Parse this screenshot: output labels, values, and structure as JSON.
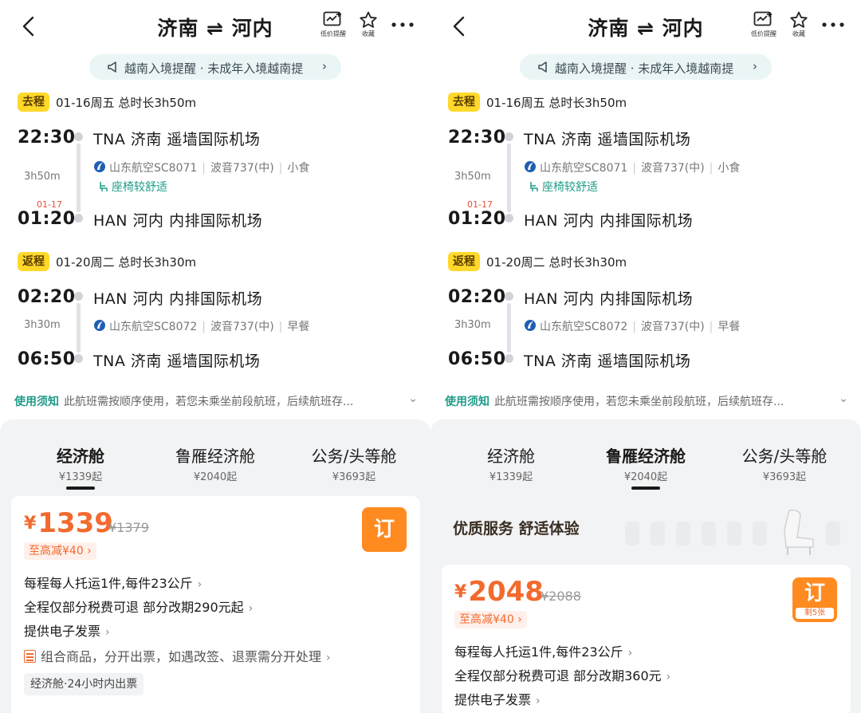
{
  "screens": [
    {
      "header": {
        "title": "济南 ⇌ 河内",
        "watch_label": "低价提醒",
        "fav_label": "收藏"
      },
      "banner": {
        "text": "越南入境提醒 · 未成年入境越南提"
      },
      "outbound": {
        "tag": "去程",
        "info": "01-16周五  总时长3h50m",
        "dep_time": "22:30",
        "arr_time": "01:20",
        "arr_nextday": "01-17",
        "duration": "3h50m",
        "dep_airport": "TNA  济南  遥墙国际机场",
        "arr_airport": "HAN  河内  内排国际机场",
        "airline": "山东航空SC8071",
        "aircraft": "波音737(中)",
        "meal": "小食",
        "comfort": "座椅较舒适"
      },
      "return": {
        "tag": "返程",
        "info": "01-20周二  总时长3h30m",
        "dep_time": "02:20",
        "arr_time": "06:50",
        "duration": "3h30m",
        "dep_airport": "HAN  河内  内排国际机场",
        "arr_airport": "TNA  济南  遥墙国际机场",
        "airline": "山东航空SC8072",
        "aircraft": "波音737(中)",
        "meal": "早餐"
      },
      "rules": {
        "label": "使用须知",
        "text": "此航班需按顺序使用，若您未乘坐前段航班，后续航班存..."
      },
      "cabins": [
        {
          "name": "经济舱",
          "price": "¥1339起"
        },
        {
          "name": "鲁雁经济舱",
          "price": "¥2040起"
        },
        {
          "name": "公务/头等舱",
          "price": "¥3693起"
        }
      ],
      "offer": {
        "yen": "¥",
        "price": "1339",
        "orig_price": "¥1379",
        "discount": "至高减¥40",
        "book_label": "订",
        "features": [
          "每程每人托运1件,每件23公斤",
          "全程仅部分税费可退 部分改期290元起",
          "提供电子发票"
        ],
        "combo": "组合商品，分开出票，如遇改签、退票需分开处理",
        "badge": "经济舱·24小时内出票"
      }
    },
    {
      "header": {
        "title": "济南 ⇌ 河内",
        "watch_label": "低价提醒",
        "fav_label": "收藏"
      },
      "banner": {
        "text": "越南入境提醒 · 未成年入境越南提"
      },
      "outbound": {
        "tag": "去程",
        "info": "01-16周五  总时长3h50m",
        "dep_time": "22:30",
        "arr_time": "01:20",
        "arr_nextday": "01-17",
        "duration": "3h50m",
        "dep_airport": "TNA  济南  遥墙国际机场",
        "arr_airport": "HAN  河内  内排国际机场",
        "airline": "山东航空SC8071",
        "aircraft": "波音737(中)",
        "meal": "小食",
        "comfort": "座椅较舒适"
      },
      "return": {
        "tag": "返程",
        "info": "01-20周二  总时长3h30m",
        "dep_time": "02:20",
        "arr_time": "06:50",
        "duration": "3h30m",
        "dep_airport": "HAN  河内  内排国际机场",
        "arr_airport": "TNA  济南  遥墙国际机场",
        "airline": "山东航空SC8072",
        "aircraft": "波音737(中)",
        "meal": "早餐"
      },
      "rules": {
        "label": "使用须知",
        "text": "此航班需按顺序使用，若您未乘坐前段航班，后续航班存..."
      },
      "cabins": [
        {
          "name": "经济舱",
          "price": "¥1339起"
        },
        {
          "name": "鲁雁经济舱",
          "price": "¥2040起"
        },
        {
          "name": "公务/头等舱",
          "price": "¥3693起"
        }
      ],
      "promo": {
        "text": "优质服务  舒适体验"
      },
      "offer": {
        "yen": "¥",
        "price": "2048",
        "orig_price": "¥2088",
        "discount": "至高减¥40",
        "book_label": "订",
        "remaining": "剩5张",
        "features": [
          "每程每人托运1件,每件23公斤",
          "全程仅部分税费可退 部分改期360元",
          "提供电子发票"
        ]
      }
    }
  ],
  "active_cabin": [
    0,
    1
  ],
  "colors": {
    "accent_orange": "#f26a2e",
    "book_button": "#ff8a1f",
    "teal": "#1e9b8a",
    "tag_yellow": "#ffd82a"
  },
  "icons": [
    "back-arrow-icon",
    "price-watch-icon",
    "star-icon",
    "more-icon",
    "megaphone-icon",
    "airline-logo-icon",
    "seat-icon",
    "chevron-right-icon",
    "chevron-down-icon",
    "combo-doc-icon"
  ]
}
